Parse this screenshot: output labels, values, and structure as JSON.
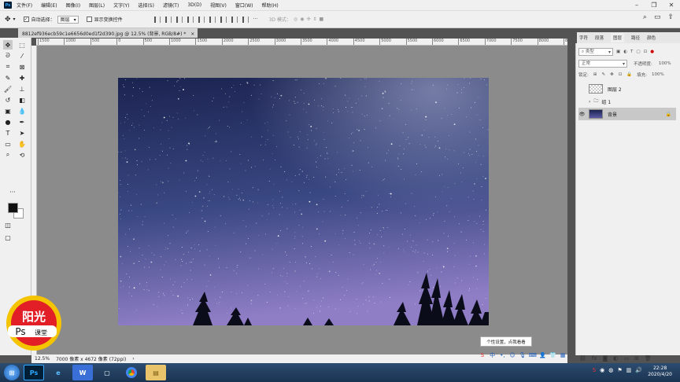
{
  "menu": {
    "items": [
      "文件(F)",
      "编辑(E)",
      "图像(I)",
      "图层(L)",
      "文字(Y)",
      "选择(S)",
      "滤镜(T)",
      "3D(D)",
      "视图(V)",
      "窗口(W)",
      "帮助(H)"
    ]
  },
  "options": {
    "auto_select_label": "自动选择：",
    "auto_select_value": "图层",
    "show_transform_label": "显示变换控件",
    "mode_3d_label": "3D 模式："
  },
  "document": {
    "tab_title": "8812ef936ecb59c1e6656d0ed1f2d390.jpg @ 12.5% (背景, RGB/8#) *",
    "zoom": "12.5%",
    "size_info": "7000 像素 x 4672 像素 (72ppi)"
  },
  "ruler": {
    "ticks": [
      "1500",
      "1000",
      "500",
      "0",
      "500",
      "1000",
      "1500",
      "2000",
      "2500",
      "3000",
      "3500",
      "4000",
      "4500",
      "5000",
      "5500",
      "6000",
      "6500",
      "7000",
      "7500",
      "8000",
      "8500"
    ]
  },
  "panel": {
    "tabs": [
      "字符",
      "段落",
      "图层",
      "路径",
      "颜色"
    ],
    "active_tab": "图层",
    "filter_kind": "类型",
    "blend_mode": "正常",
    "opacity_label": "不透明度:",
    "opacity_value": "100%",
    "lock_label": "锁定:",
    "fill_label": "填充:",
    "fill_value": "100%",
    "layers": [
      {
        "name": "图层 2"
      },
      {
        "name": "组 1"
      },
      {
        "name": "背景"
      }
    ]
  },
  "tooltip": {
    "text": "个性设置，点我看看"
  },
  "logo": {
    "top_text": "阳光",
    "ps_text": "Ps",
    "bottom_text": "课堂"
  },
  "taskbar": {
    "time": "22:28",
    "date": "2020/4/20"
  },
  "colors": {
    "accent": "#31a8ff",
    "sky_top": "#1d2551",
    "sky_bottom": "#8f7ec6"
  }
}
